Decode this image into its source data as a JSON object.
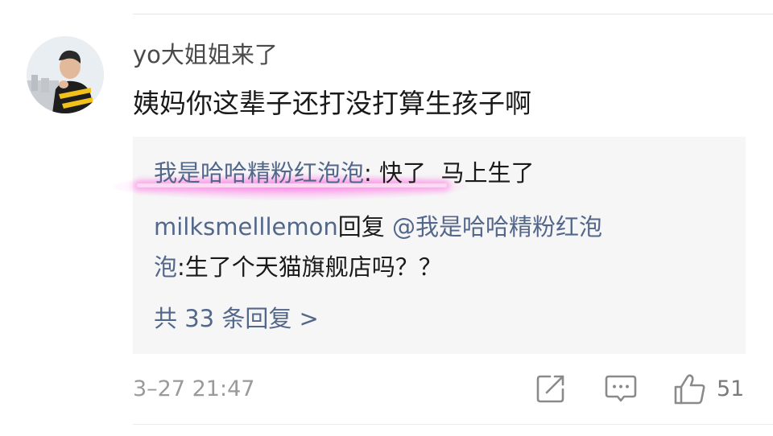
{
  "comment": {
    "username": "yo大姐姐来了",
    "text": "姨妈你这辈子还打没打算生孩子啊",
    "avatar_icon": "user-avatar"
  },
  "replies": [
    {
      "author": "我是哈哈精粉红泡泡",
      "separator": ": ",
      "text": "快了  马上生了"
    },
    {
      "author": "milksmelllemon",
      "action_text": "回复",
      "mention": "@我是哈哈精粉红泡",
      "mention_cont": "泡",
      "text": ":生了个天猫旗舰店吗？？"
    }
  ],
  "more_replies_label": "共 33 条回复 >",
  "footer": {
    "timestamp": "3–27 21:47",
    "like_count": "51",
    "icons": [
      "share-icon",
      "comment-icon",
      "like-icon"
    ]
  },
  "colors": {
    "link": "#53678b",
    "text": "#1a1a1a",
    "meta": "#9a9a9a",
    "reply_bg": "#f6f6f6",
    "highlight": "#ff78e6"
  }
}
